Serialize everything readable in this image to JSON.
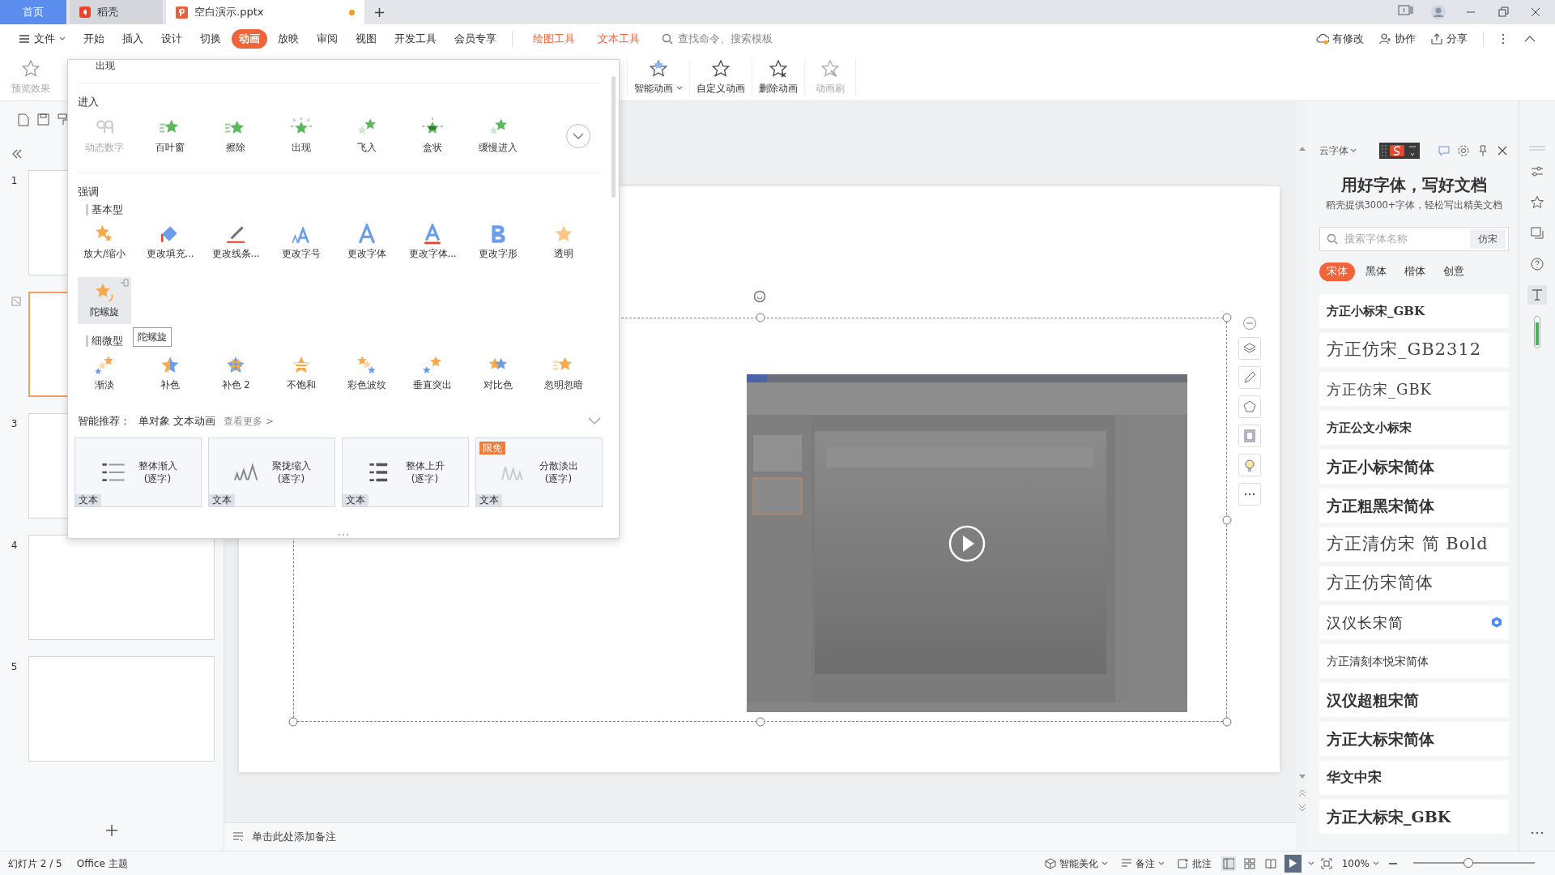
{
  "title_bar": {
    "tabs": [
      {
        "label": "首页",
        "kind": "home",
        "selected": false
      },
      {
        "label": "稻壳",
        "kind": "docer",
        "selected": false
      },
      {
        "label": "空白演示.pptx",
        "kind": "file",
        "selected": true,
        "modified": true
      }
    ]
  },
  "menu": {
    "items": [
      {
        "label": "文件",
        "kind": "file",
        "selected": false
      },
      {
        "label": "开始",
        "kind": "normal",
        "selected": false
      },
      {
        "label": "插入",
        "kind": "normal",
        "selected": false
      },
      {
        "label": "设计",
        "kind": "normal",
        "selected": false
      },
      {
        "label": "切换",
        "kind": "normal",
        "selected": false
      },
      {
        "label": "动画",
        "kind": "normal",
        "selected": true
      },
      {
        "label": "放映",
        "kind": "normal",
        "selected": false
      },
      {
        "label": "审阅",
        "kind": "normal",
        "selected": false
      },
      {
        "label": "视图",
        "kind": "normal",
        "selected": false
      },
      {
        "label": "开发工具",
        "kind": "normal",
        "selected": false
      },
      {
        "label": "会员专享",
        "kind": "normal",
        "selected": false
      },
      {
        "label": "绘图工具",
        "kind": "context",
        "selected": false
      },
      {
        "label": "文本工具",
        "kind": "context",
        "selected": false
      }
    ],
    "search": {
      "placeholder": "查找命令、搜索模板"
    },
    "actions": [
      {
        "label": "有修改",
        "kind": "cloud"
      },
      {
        "label": "协作",
        "kind": "user"
      },
      {
        "label": "分享",
        "kind": "share"
      }
    ]
  },
  "ribbon": {
    "left_buttons": [
      {
        "label": "预览效果",
        "disabled": true,
        "dropdown": false
      }
    ],
    "right_buttons": [
      {
        "label": "智能动画",
        "disabled": false,
        "dropdown": true
      },
      {
        "label": "自定义动画",
        "disabled": false,
        "dropdown": false
      },
      {
        "label": "删除动画",
        "disabled": false,
        "dropdown": false
      },
      {
        "label": "动画刷",
        "disabled": true,
        "dropdown": false
      }
    ]
  },
  "animation_gallery": {
    "clipped_label": "出现",
    "entrance": {
      "title": "进入",
      "items": [
        {
          "label": "动态数字",
          "disabled": true
        },
        {
          "label": "百叶窗",
          "disabled": false
        },
        {
          "label": "擦除",
          "disabled": false
        },
        {
          "label": "出现",
          "disabled": false
        },
        {
          "label": "飞入",
          "disabled": false
        },
        {
          "label": "盒状",
          "disabled": false
        },
        {
          "label": "缓慢进入",
          "disabled": false
        }
      ]
    },
    "emphasis": {
      "title": "强调",
      "groups": [
        {
          "title": "基本型",
          "items": [
            {
              "label": "放大/缩小",
              "selected": false
            },
            {
              "label": "更改填充...",
              "selected": false
            },
            {
              "label": "更改线条...",
              "selected": false
            },
            {
              "label": "更改字号",
              "selected": false
            },
            {
              "label": "更改字体",
              "selected": false
            },
            {
              "label": "更改字体...",
              "selected": false
            },
            {
              "label": "更改字形",
              "selected": false
            },
            {
              "label": "透明",
              "selected": false
            },
            {
              "label": "陀螺旋",
              "selected": true
            }
          ]
        },
        {
          "title": "细微型",
          "items": [
            {
              "label": "渐淡",
              "selected": false
            },
            {
              "label": "补色",
              "selected": false
            },
            {
              "label": "补色 2",
              "selected": false
            },
            {
              "label": "不饱和",
              "selected": false
            },
            {
              "label": "彩色波纹",
              "selected": false
            },
            {
              "label": "垂直突出",
              "selected": false
            },
            {
              "label": "对比色",
              "selected": false
            },
            {
              "label": "忽明忽暗",
              "selected": false
            }
          ]
        }
      ]
    },
    "tooltip": "陀螺旋",
    "recommend": {
      "title": "智能推荐：",
      "subtitle": "单对象 文本动画",
      "more": "查看更多 >",
      "cards": [
        {
          "line1": "整体渐入",
          "line2": "(逐字)",
          "tag": "文本"
        },
        {
          "line1": "聚拢缩入",
          "line2": "(逐字)",
          "tag": "文本"
        },
        {
          "line1": "整体上升",
          "line2": "(逐字)",
          "tag": "文本"
        },
        {
          "line1": "分散淡出",
          "line2": "(逐字)",
          "tag": "文本",
          "promo": "限免"
        }
      ]
    }
  },
  "slides_pane": {
    "slides": [
      {
        "number": "1",
        "selected": false
      },
      {
        "selected": true
      },
      {
        "number": "3",
        "selected": false
      },
      {
        "number": "4",
        "selected": false
      },
      {
        "number": "5",
        "selected": false
      }
    ]
  },
  "notes": {
    "placeholder": "单击此处添加备注"
  },
  "font_panel": {
    "title": "云字体",
    "heading": "用好字体，写好文档",
    "subheading": "稻壳提供3000+字体，轻松写出精美文档",
    "search": {
      "placeholder": "搜索字体名称",
      "button": "仿宋"
    },
    "categories": [
      {
        "label": "宋体",
        "selected": true
      },
      {
        "label": "黑体",
        "selected": false
      },
      {
        "label": "楷体",
        "selected": false
      },
      {
        "label": "创意",
        "selected": false
      }
    ],
    "fonts": [
      {
        "name": "方正小标宋_GBK",
        "kind": "title",
        "free": false
      },
      {
        "name": "方正仿宋_GB2312",
        "kind": "thin",
        "free": false
      },
      {
        "name": "方正仿宋_GBK",
        "kind": "thin-small",
        "free": false
      },
      {
        "name": "方正公文小标宋",
        "kind": "title",
        "free": false
      },
      {
        "name": "方正小标宋简体",
        "kind": "bold",
        "free": false
      },
      {
        "name": "方正粗黑宋简体",
        "kind": "heavy",
        "free": false
      },
      {
        "name": "方正清仿宋 简 Bold",
        "kind": "thin",
        "free": false
      },
      {
        "name": "方正仿宋简体",
        "kind": "thin",
        "free": false
      },
      {
        "name": "汉仪长宋简",
        "kind": "plain",
        "free": true
      },
      {
        "name": "方正清刻本悦宋简体",
        "kind": "small",
        "free": false
      },
      {
        "name": "汉仪超粗宋简",
        "kind": "heavy",
        "free": false
      },
      {
        "name": "方正大标宋简体",
        "kind": "heavy",
        "free": false
      },
      {
        "name": "华文中宋",
        "kind": "medium",
        "free": false
      },
      {
        "name": "方正大标宋_GBK",
        "kind": "heavy",
        "free": false
      }
    ]
  },
  "status_bar": {
    "slide_info": "幻灯片 2 / 5",
    "theme": "Office 主题",
    "beautify": "智能美化",
    "notes": "备注",
    "comments": "批注",
    "views": [
      {
        "kind": "normal",
        "selected": true
      },
      {
        "kind": "sorter",
        "selected": false
      },
      {
        "kind": "reading",
        "selected": false
      }
    ],
    "zoom": "100%",
    "zoom_slider": {
      "level": 0.45
    }
  }
}
